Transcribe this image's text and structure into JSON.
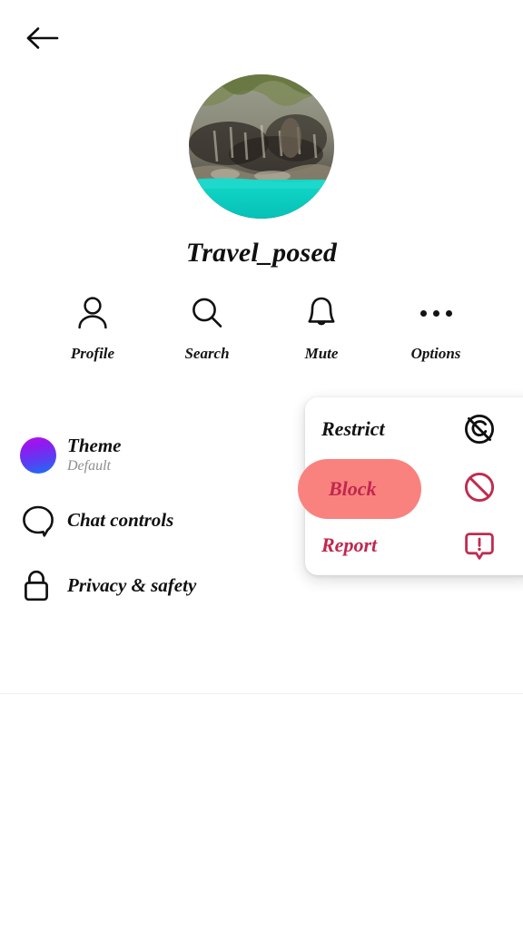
{
  "header": {
    "back_icon": "arrow-left-icon"
  },
  "profile": {
    "username": "Travel_posed",
    "avatar_alt": "cave-lagoon-photo"
  },
  "actions": [
    {
      "label": "Profile",
      "icon": "person-icon"
    },
    {
      "label": "Search",
      "icon": "search-icon"
    },
    {
      "label": "Mute",
      "icon": "bell-icon"
    },
    {
      "label": "Options",
      "icon": "ellipsis-icon"
    }
  ],
  "settings": [
    {
      "title": "Theme",
      "subtitle": "Default",
      "icon": "theme-gradient-circle-icon"
    },
    {
      "title": "Chat controls",
      "subtitle": "",
      "icon": "speech-bubble-icon"
    },
    {
      "title": "Privacy & safety",
      "subtitle": "",
      "icon": "lock-icon"
    }
  ],
  "popup": {
    "items": [
      {
        "label": "Restrict",
        "icon": "restrict-crossed-eye-icon",
        "selected": false
      },
      {
        "label": "Block",
        "icon": "block-no-entry-icon",
        "selected": true
      },
      {
        "label": "Report",
        "icon": "report-exclamation-icon",
        "selected": false
      }
    ]
  },
  "colors": {
    "danger": "#c0274e",
    "highlight_pill": "#f9827e",
    "theme_gradient_start": "#b312ec",
    "theme_gradient_end": "#1775f2",
    "icon_dark": "#121212",
    "subtitle_grey": "#8d8d8d",
    "divider": "#eceef0",
    "avatar_water": "#15d2c4"
  }
}
